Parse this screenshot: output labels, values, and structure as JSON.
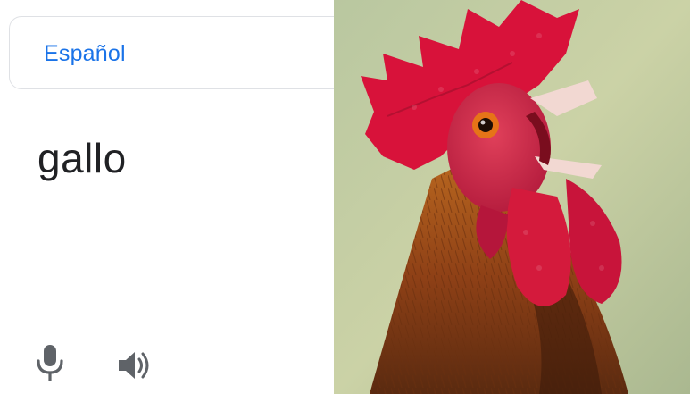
{
  "translate_card": {
    "language_label": "Español",
    "word": "gallo",
    "mic_icon": "microphone-icon",
    "speaker_icon": "speaker-icon"
  },
  "photo": {
    "subject": "rooster-head-photo",
    "colors": {
      "comb": "#d8123a",
      "background": "#c7cf9f",
      "feathers": "#9a4a1c",
      "eye": "#e67418"
    }
  },
  "colors": {
    "accent": "#1a73e8",
    "text": "#202124",
    "icon": "#5f6368",
    "border": "#dfe1e5"
  }
}
